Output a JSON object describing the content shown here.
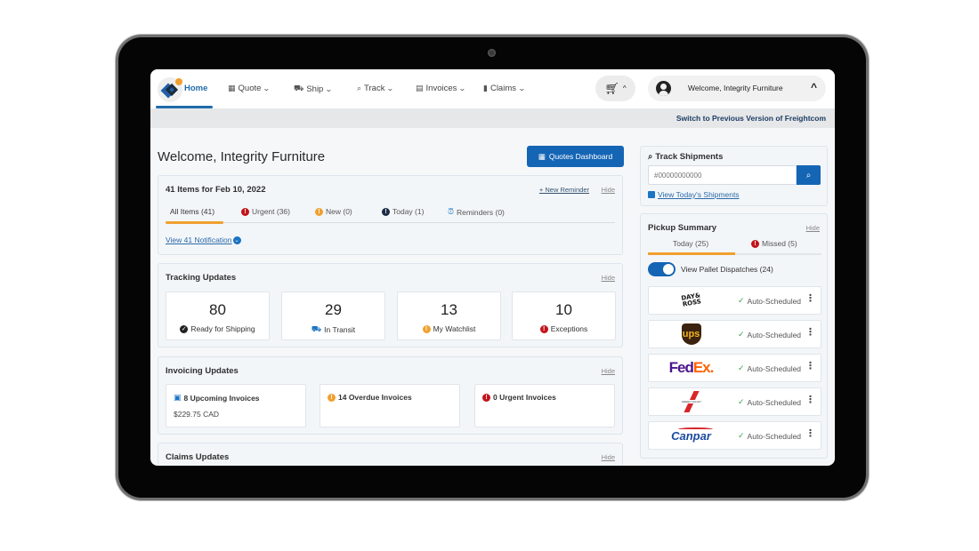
{
  "nav": {
    "items": [
      {
        "label": "Home",
        "icon": "home-logo",
        "active": true
      },
      {
        "label": "Quote",
        "icon": "calculator-icon"
      },
      {
        "label": "Ship",
        "icon": "truck-icon"
      },
      {
        "label": "Track",
        "icon": "search-icon"
      },
      {
        "label": "Invoices",
        "icon": "file-invoice-icon"
      },
      {
        "label": "Claims",
        "icon": "file-icon"
      }
    ],
    "cart_icon": "cart-icon",
    "user_greeting": "Welcome, Integrity Furniture"
  },
  "subbar": {
    "switch_link": "Switch to Previous Version of Freightcom"
  },
  "page": {
    "title": "Welcome, Integrity Furniture",
    "quotes_button": "Quotes Dashboard"
  },
  "items_card": {
    "title": "41 Items for Feb 10, 2022",
    "new_reminder": "+ New Reminder",
    "hide": "Hide",
    "tabs": [
      {
        "label": "All Items (41)",
        "active": true
      },
      {
        "label": "Urgent (36)",
        "badge": "red"
      },
      {
        "label": "New (0)",
        "badge": "orange"
      },
      {
        "label": "Today (1)",
        "badge": "navy"
      },
      {
        "label": "Reminders (0)",
        "icon": "alarm-clock-icon"
      }
    ],
    "view_link": "View 41 Notification"
  },
  "tracking": {
    "title": "Tracking Updates",
    "hide": "Hide",
    "stats": [
      {
        "value": "80",
        "label": "Ready for Shipping",
        "icon": "check-circle-icon"
      },
      {
        "value": "29",
        "label": "In Transit",
        "icon": "truck-icon"
      },
      {
        "value": "13",
        "label": "My Watchlist",
        "icon": "warning-icon"
      },
      {
        "value": "10",
        "label": "Exceptions",
        "icon": "error-icon"
      }
    ]
  },
  "invoicing": {
    "title": "Invoicing Updates",
    "hide": "Hide",
    "boxes": [
      {
        "label": "8 Upcoming Invoices",
        "amount": "$229.75 CAD",
        "icon": "gift-icon"
      },
      {
        "label": "14 Overdue Invoices",
        "icon": "warning-icon"
      },
      {
        "label": "0 Urgent Invoices",
        "icon": "error-icon"
      }
    ]
  },
  "claims": {
    "title": "Claims Updates",
    "hide": "Hide"
  },
  "track_shipments": {
    "title": "Track Shipments",
    "placeholder": "#00000000000",
    "today_link": "View Today's Shipments"
  },
  "pickup": {
    "title": "Pickup Summary",
    "hide": "Hide",
    "tabs": [
      {
        "label": "Today (25)",
        "active": true
      },
      {
        "label": "Missed (5)",
        "badge": "red"
      }
    ],
    "toggle_label": "View Pallet Dispatches (24)",
    "toggle_on": true,
    "carriers": [
      {
        "name": "Day & Ross",
        "status": "Auto-Scheduled"
      },
      {
        "name": "UPS",
        "logo_text": "ups",
        "status": "Auto-Scheduled"
      },
      {
        "name": "FedEx",
        "logo_fed": "Fed",
        "logo_ex": "Ex",
        "status": "Auto-Scheduled"
      },
      {
        "name": "Green Valley",
        "status": "Auto-Scheduled"
      },
      {
        "name": "Canpar",
        "logo_text": "Canpar",
        "status": "Auto-Scheduled"
      }
    ]
  }
}
